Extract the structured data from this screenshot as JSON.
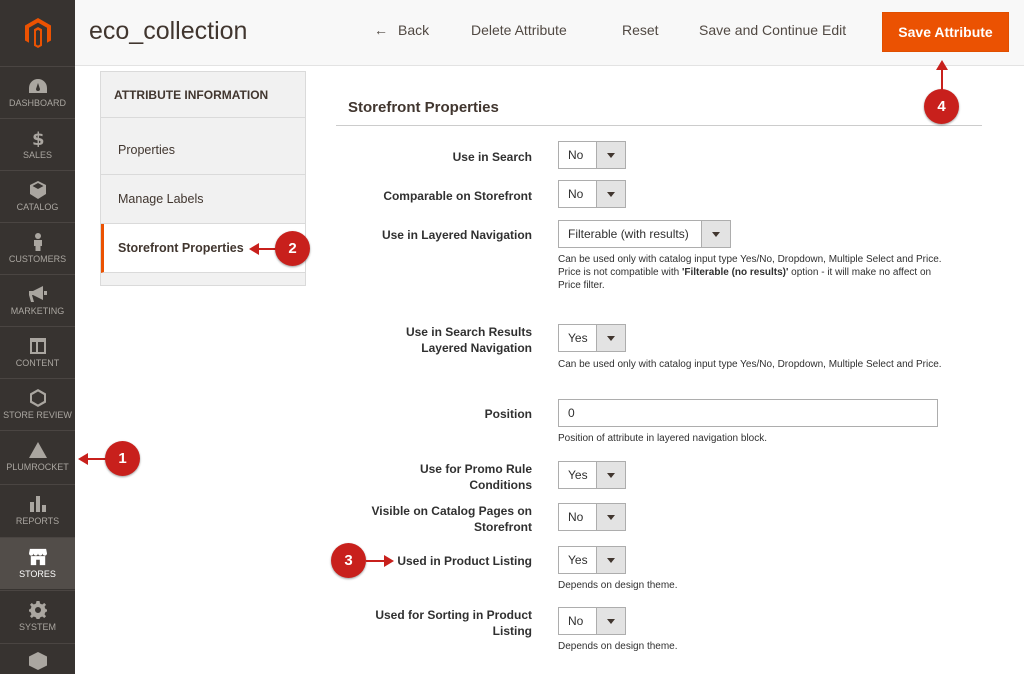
{
  "sidebar": {
    "items": [
      {
        "label": "DASHBOARD",
        "icon": "dashboard-icon"
      },
      {
        "label": "SALES",
        "icon": "dollar-icon"
      },
      {
        "label": "CATALOG",
        "icon": "cube-icon"
      },
      {
        "label": "CUSTOMERS",
        "icon": "person-icon"
      },
      {
        "label": "MARKETING",
        "icon": "megaphone-icon"
      },
      {
        "label": "CONTENT",
        "icon": "layout-icon"
      },
      {
        "label": "STORE REVIEW",
        "icon": "hexagon-icon"
      },
      {
        "label": "PLUMROCKET",
        "icon": "pyramid-icon"
      },
      {
        "label": "REPORTS",
        "icon": "bar-chart-icon"
      },
      {
        "label": "STORES",
        "icon": "storefront-icon"
      },
      {
        "label": "SYSTEM",
        "icon": "gear-icon"
      }
    ],
    "active": "STORES",
    "brand_color": "#eb5202"
  },
  "header": {
    "title": "eco_collection",
    "back_label": "Back",
    "delete_label": "Delete Attribute",
    "reset_label": "Reset",
    "save_continue_label": "Save and Continue Edit",
    "save_label": "Save Attribute"
  },
  "tabs": {
    "title": "ATTRIBUTE INFORMATION",
    "items": [
      "Properties",
      "Manage Labels",
      "Storefront Properties"
    ],
    "active": "Storefront Properties"
  },
  "section": {
    "title": "Storefront Properties",
    "fields": {
      "use_in_search": {
        "label": "Use in Search",
        "value": "No"
      },
      "comparable": {
        "label": "Comparable on Storefront",
        "value": "No"
      },
      "layered_nav": {
        "label": "Use in Layered Navigation",
        "value": "Filterable (with results)",
        "note1": "Can be used only with catalog input type Yes/No, Dropdown, Multiple Select and Price.",
        "note2_pre": "Price is not compatible with ",
        "note2_bold": "'Filterable (no results)'",
        "note2_post": " option - it will make no affect on Price filter."
      },
      "search_layered": {
        "label_line1": "Use in Search Results",
        "label_line2": "Layered Navigation",
        "value": "Yes",
        "note": "Can be used only with catalog input type Yes/No, Dropdown, Multiple Select and Price."
      },
      "position": {
        "label": "Position",
        "value": "0",
        "note": "Position of attribute in layered navigation block."
      },
      "promo": {
        "label_line1": "Use for Promo Rule",
        "label_line2": "Conditions",
        "value": "Yes"
      },
      "visible_catalog": {
        "label_line1": "Visible on Catalog Pages on",
        "label_line2": "Storefront",
        "value": "No"
      },
      "product_listing": {
        "label": "Used in Product Listing",
        "value": "Yes",
        "note": "Depends on design theme."
      },
      "sorting": {
        "label_line1": "Used for Sorting in Product",
        "label_line2": "Listing",
        "value": "No",
        "note": "Depends on design theme."
      }
    }
  },
  "callouts": [
    "1",
    "2",
    "3",
    "4"
  ],
  "callout_color": "#c8201c"
}
